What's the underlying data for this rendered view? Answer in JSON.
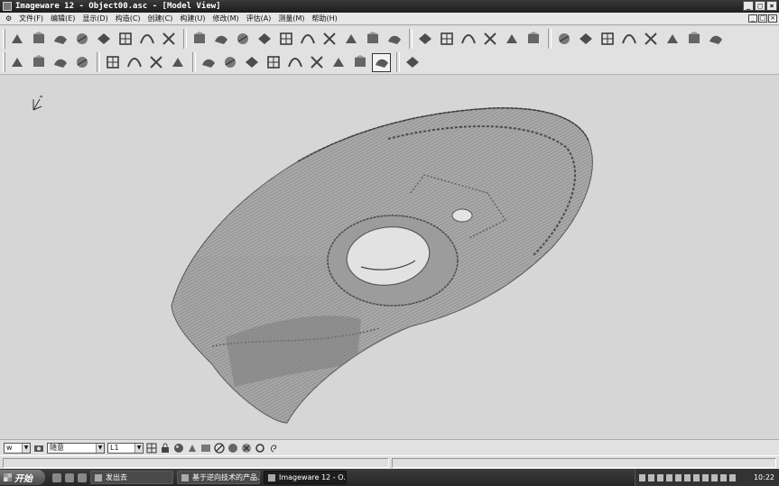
{
  "window": {
    "title": "Imageware 12 - Object00.asc - [Model View]",
    "controls": [
      "_",
      "□",
      "×"
    ],
    "doc_controls": [
      "_",
      "□",
      "×"
    ]
  },
  "menu": [
    "文件(F)",
    "编辑(E)",
    "显示(D)",
    "构造(C)",
    "创建(C)",
    "构建(U)",
    "修改(M)",
    "评估(A)",
    "测量(M)",
    "帮助(H)"
  ],
  "menu_icon": "app-menu-icon",
  "toolbar": {
    "row1": [
      "open-file-icon",
      "scan-points-icon",
      "polygonize-icon",
      "curve-from-points-icon",
      "sample-points-icon",
      "extract-section-icon",
      "grid-cloud-icon",
      "surface-cloud-icon",
      "sep",
      "plane-icon",
      "diamond-surface-icon",
      "box-surface-icon",
      "blend-surface-icon",
      "sweep-surface-icon",
      "loft-surface-icon",
      "offset-surface-icon",
      "trim-surface-icon",
      "cone-surface-icon",
      "pyramid-surface-icon",
      "sep",
      "wire-cube-icon",
      "wire-block-icon",
      "node-star-icon",
      "ring-surface-icon",
      "lightning-curve-icon",
      "rotate-axis-icon",
      "sep",
      "surface-patch-icon",
      "fillet-icon",
      "solid-shade-icon",
      "n-curve-icon",
      "slab-icon",
      "stack-icon",
      "cylinder-stack-icon",
      "spark-icon"
    ],
    "row2": [
      "manual-scan-icon",
      "slice-points-icon",
      "section-stack-icon",
      "edge-extract-icon",
      "sep",
      "cloud-shape-icon",
      "spline-wave-icon",
      "point-cluster-icon",
      "arc-fan-icon",
      "sep",
      "grid-mesh-icon",
      "zigzag-curve-icon",
      "snake-curve-icon",
      "dotted-curve-icon",
      "target-circle-icon",
      "s-curve-icon",
      "arrow-swoop-icon",
      "scissor-cross-icon",
      "wheel-icon",
      "sep",
      "palette-icon"
    ],
    "active_tool": "wheel-icon"
  },
  "viewport": {
    "label": "Model View",
    "axis_label": "triad-axis-icon"
  },
  "statusbar": {
    "view_select": "w",
    "layer_select": "随意",
    "line_select": "L1"
  },
  "taskbar": {
    "start_label": "开始",
    "tasks": [
      {
        "label": "发出去",
        "active": false
      },
      {
        "label": "基于逆向技术的产品...",
        "active": false
      },
      {
        "label": "Imageware 12  - O...",
        "active": true
      }
    ],
    "clock": "10:22"
  },
  "colors": {
    "background": "#d6d6d6",
    "model_stroke": "#5a5a5a",
    "titlebar": "#1c1c1c"
  }
}
